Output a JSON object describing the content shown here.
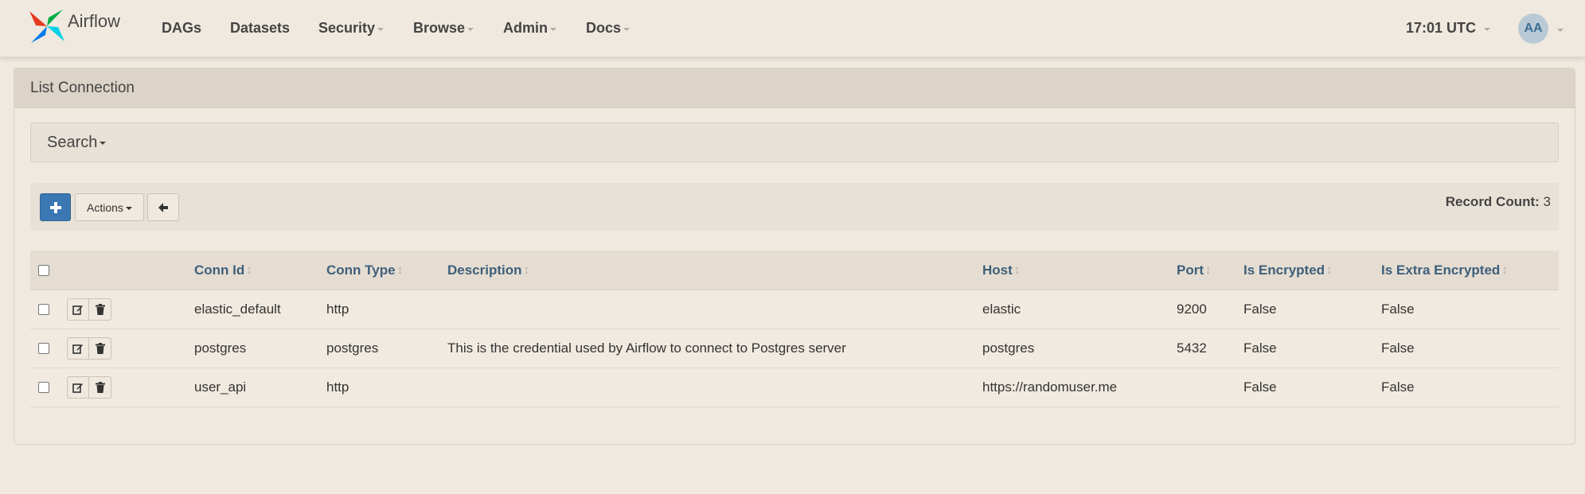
{
  "nav": {
    "brand": "Airflow",
    "items": [
      {
        "label": "DAGs",
        "dropdown": false
      },
      {
        "label": "Datasets",
        "dropdown": false
      },
      {
        "label": "Security",
        "dropdown": true
      },
      {
        "label": "Browse",
        "dropdown": true
      },
      {
        "label": "Admin",
        "dropdown": true
      },
      {
        "label": "Docs",
        "dropdown": true
      }
    ],
    "clock": "17:01 UTC",
    "avatar": "AA"
  },
  "panel": {
    "title": "List Connection",
    "search_label": "Search",
    "actions_label": "Actions",
    "record_count_label": "Record Count:",
    "record_count": "3"
  },
  "table": {
    "columns": [
      "Conn Id",
      "Conn Type",
      "Description",
      "Host",
      "Port",
      "Is Encrypted",
      "Is Extra Encrypted"
    ],
    "rows": [
      {
        "conn_id": "elastic_default",
        "conn_type": "http",
        "description": "",
        "host": "elastic",
        "port": "9200",
        "is_encrypted": "False",
        "is_extra_encrypted": "False"
      },
      {
        "conn_id": "postgres",
        "conn_type": "postgres",
        "description": "This is the credential used by Airflow to connect to Postgres server",
        "host": "postgres",
        "port": "5432",
        "is_encrypted": "False",
        "is_extra_encrypted": "False"
      },
      {
        "conn_id": "user_api",
        "conn_type": "http",
        "description": "",
        "host": "https://randomuser.me",
        "port": "",
        "is_encrypted": "False",
        "is_extra_encrypted": "False"
      }
    ]
  },
  "colors": {
    "background": "#f0e9df",
    "primary_button": "#3b78b3",
    "header_text": "#3e5f7a"
  },
  "icons": [
    "airflow-logo-icon",
    "plus-icon",
    "arrow-left-icon",
    "edit-icon",
    "trash-icon",
    "sort-icon"
  ]
}
